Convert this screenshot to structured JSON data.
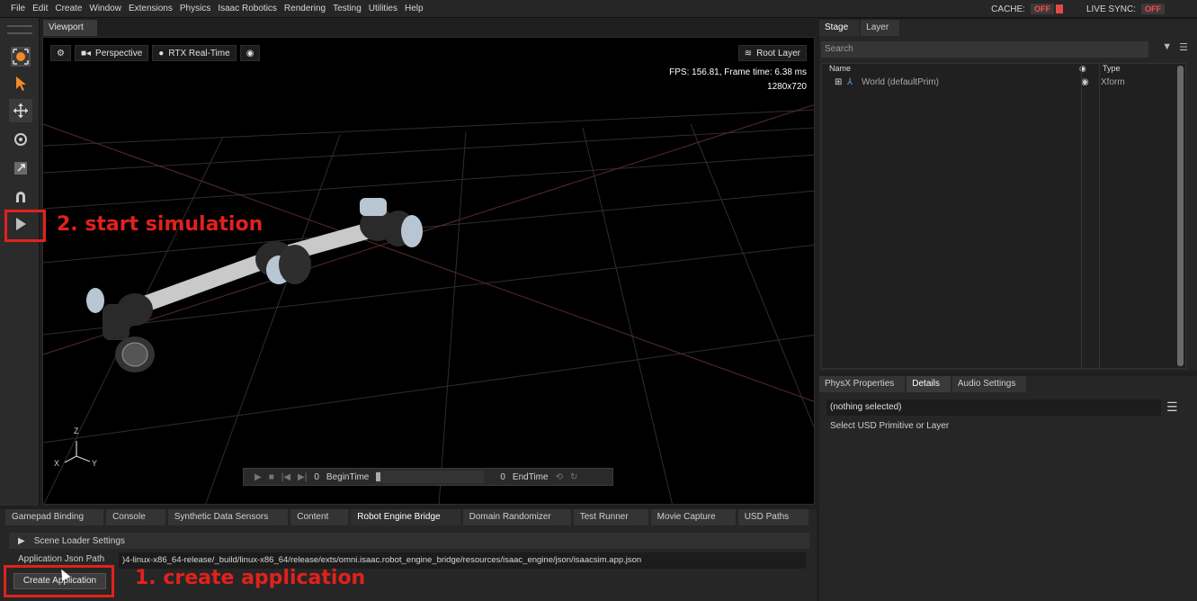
{
  "menubar": {
    "items": [
      "File",
      "Edit",
      "Create",
      "Window",
      "Extensions",
      "Physics",
      "Isaac Robotics",
      "Rendering",
      "Testing",
      "Utilities",
      "Help"
    ],
    "cache_label": "CACHE:",
    "cache_state": "OFF",
    "live_sync_label": "LIVE SYNC:",
    "live_sync_state": "OFF"
  },
  "toolbar": {
    "icons": [
      "select-mode-icon",
      "pointer-icon",
      "move-icon",
      "rotate-icon",
      "scale-icon",
      "snap-magnet-icon",
      "play-icon"
    ]
  },
  "viewport": {
    "tab": "Viewport",
    "camera": "Perspective",
    "renderer": "RTX Real-Time",
    "root_layer": "Root Layer",
    "fps_line": "FPS: 156.81, Frame time: 6.38 ms",
    "resolution": "1280x720",
    "axis": {
      "z": "Z",
      "x": "X",
      "y": "Y"
    },
    "timeline": {
      "start_value": "0",
      "begin_label": "BeginTime",
      "current": "0",
      "end_value": "0",
      "end_label": "EndTime"
    }
  },
  "annotations": {
    "start": "2. start simulation",
    "create": "1. create application",
    "color": "#e2211c"
  },
  "stage": {
    "tabs": [
      "Stage",
      "Layer"
    ],
    "search_placeholder": "Search",
    "col_name": "Name",
    "col_type": "Type",
    "rows": [
      {
        "name": "World (defaultPrim)",
        "type": "Xform"
      }
    ]
  },
  "properties": {
    "tabs": [
      "PhysX Properties",
      "Details",
      "Audio Settings"
    ],
    "selection": "(nothing selected)",
    "hint": "Select USD Primitive or Layer"
  },
  "bottom": {
    "tabs": [
      "Gamepad Binding",
      "Console",
      "Synthetic Data Sensors",
      "Content",
      "Robot Engine Bridge",
      "Domain Randomizer",
      "Test Runner",
      "Movie Capture",
      "USD Paths"
    ],
    "section": "Scene Loader Settings",
    "json_label": "Application Json Path",
    "json_value": ")4-linux-x86_64-release/_build/linux-x86_64/release/exts/omni.isaac.robot_engine_bridge/resources/isaac_engine/json/isaacsim.app.json",
    "create_button": "Create Application"
  }
}
